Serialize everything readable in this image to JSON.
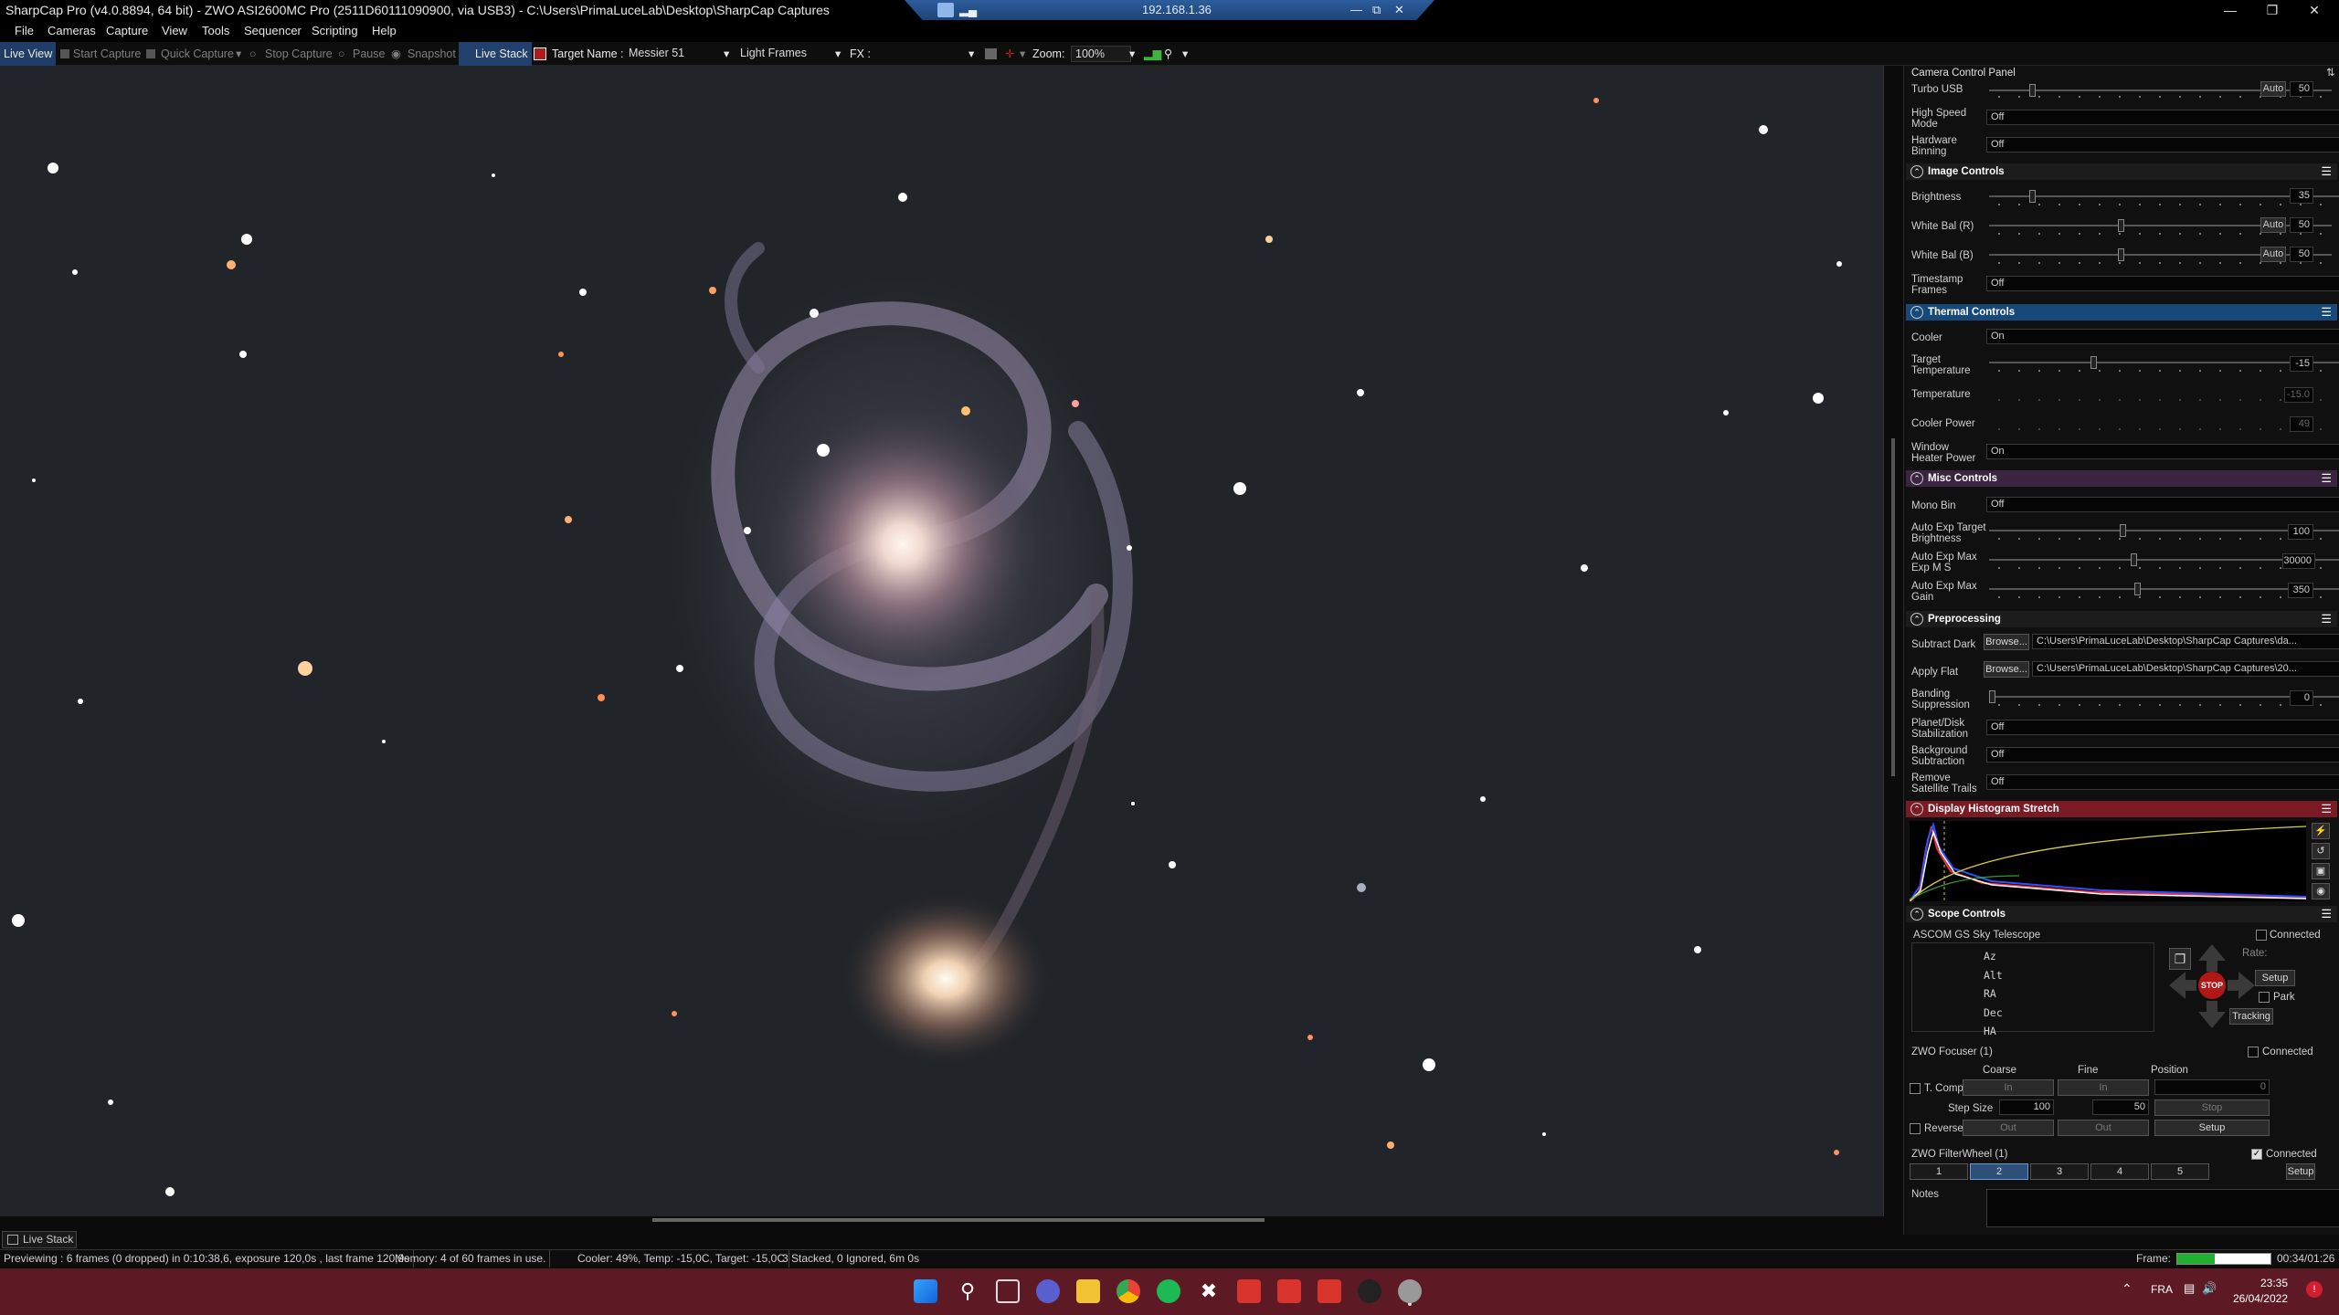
{
  "app": {
    "title": "SharpCap Pro (v4.0.8894, 64 bit) - ZWO ASI2600MC Pro (2511D60111090900, via USB3) - C:\\Users\\PrimaLuceLab\\Desktop\\SharpCap Captures",
    "remote_ip": "192.168.1.36"
  },
  "menu": [
    "File",
    "Cameras",
    "Capture",
    "View",
    "Tools",
    "Sequencer",
    "Scripting",
    "Help"
  ],
  "toolbar": {
    "live_view": "Live View",
    "start_capture": "Start Capture",
    "quick_capture": "Quick Capture",
    "stop_capture": "Stop Capture",
    "pause": "Pause",
    "snapshot": "Snapshot",
    "live_stack": "Live Stack",
    "target_name_label": "Target Name :",
    "target_name": "Messier 51",
    "frame_type": "Light Frames",
    "fx_label": "FX :",
    "zoom_label": "Zoom:",
    "zoom": "100%"
  },
  "panel": {
    "title": "Camera Control Panel",
    "turbo_usb": {
      "label": "Turbo USB",
      "value": "50",
      "auto": "Auto"
    },
    "high_speed": {
      "label": "High Speed Mode",
      "value": "Off"
    },
    "hw_binning": {
      "label": "Hardware Binning",
      "value": "Off"
    },
    "image_controls": {
      "title": "Image Controls",
      "brightness": {
        "label": "Brightness",
        "value": "35"
      },
      "wb_r": {
        "label": "White Bal (R)",
        "value": "50",
        "auto": "Auto"
      },
      "wb_b": {
        "label": "White Bal (B)",
        "value": "50",
        "auto": "Auto"
      },
      "timestamp": {
        "label": "Timestamp Frames",
        "value": "Off"
      }
    },
    "thermal": {
      "title": "Thermal Controls",
      "cooler": {
        "label": "Cooler",
        "value": "On"
      },
      "target_temp": {
        "label": "Target Temperature",
        "value": "-15"
      },
      "temperature": {
        "label": "Temperature",
        "value": "-15.0"
      },
      "cooler_power": {
        "label": "Cooler Power",
        "value": "49"
      },
      "heater": {
        "label": "Window Heater Power",
        "value": "On"
      }
    },
    "misc": {
      "title": "Misc Controls",
      "mono_bin": {
        "label": "Mono Bin",
        "value": "Off"
      },
      "auto_exp_target": {
        "label": "Auto Exp Target Brightness",
        "value": "100"
      },
      "auto_exp_max": {
        "label": "Auto Exp Max Exp M S",
        "value": "30000"
      },
      "auto_exp_gain": {
        "label": "Auto Exp Max Gain",
        "value": "350"
      }
    },
    "preprocessing": {
      "title": "Preprocessing",
      "subtract_dark": {
        "label": "Subtract Dark",
        "browse": "Browse...",
        "value": "C:\\Users\\PrimaLuceLab\\Desktop\\SharpCap Captures\\da..."
      },
      "apply_flat": {
        "label": "Apply Flat",
        "browse": "Browse...",
        "value": "C:\\Users\\PrimaLuceLab\\Desktop\\SharpCap Captures\\20..."
      },
      "banding": {
        "label": "Banding Suppression",
        "value": "0"
      },
      "planet": {
        "label": "Planet/Disk Stabilization",
        "value": "Off"
      },
      "background": {
        "label": "Background Subtraction",
        "value": "Off"
      },
      "sat_trails": {
        "label": "Remove Satellite Trails",
        "value": "Off"
      }
    },
    "histogram": {
      "title": "Display Histogram Stretch"
    },
    "scope": {
      "title": "Scope Controls",
      "telescope": "ASCOM GS Sky Telescope",
      "connected": "Connected",
      "coords": [
        "Az",
        "Alt",
        "RA",
        "Dec",
        "HA"
      ],
      "rate_label": "Rate:",
      "setup": "Setup",
      "park": "Park",
      "tracking": "Tracking",
      "stop": "STOP"
    },
    "focuser": {
      "title": "ZWO Focuser (1)",
      "connected": "Connected",
      "coarse": "Coarse",
      "fine": "Fine",
      "position": "Position",
      "tcomp": "T. Comp",
      "in": "In",
      "pos_value": "0",
      "step_size": "Step Size",
      "coarse_step": "100",
      "fine_step": "50",
      "stop": "Stop",
      "reverse": "Reverse",
      "out": "Out",
      "setup": "Setup"
    },
    "filterwheel": {
      "title": "ZWO FilterWheel (1)",
      "connected": "Connected",
      "slots": [
        "1",
        "2",
        "3",
        "4",
        "5"
      ],
      "setup": "Setup"
    },
    "notes": "Notes"
  },
  "livestack_tab": "Live Stack",
  "status": {
    "preview": "Previewing : 6 frames (0 dropped) in 0:10:38,6, exposure 120,0s , last frame 120,9s",
    "memory": "Memory: 4 of 60 frames in use.",
    "cooler": "Cooler: 49%, Temp: -15,0C, Target: -15,0C",
    "stack": "3 Stacked, 0 Ignored, 6m 0s",
    "frame_label": "Frame:",
    "frame_time": "00:34/01:26",
    "frame_progress": 0.4
  },
  "taskbar": {
    "lang": "FRA",
    "time": "23:35",
    "date": "26/04/2022"
  }
}
